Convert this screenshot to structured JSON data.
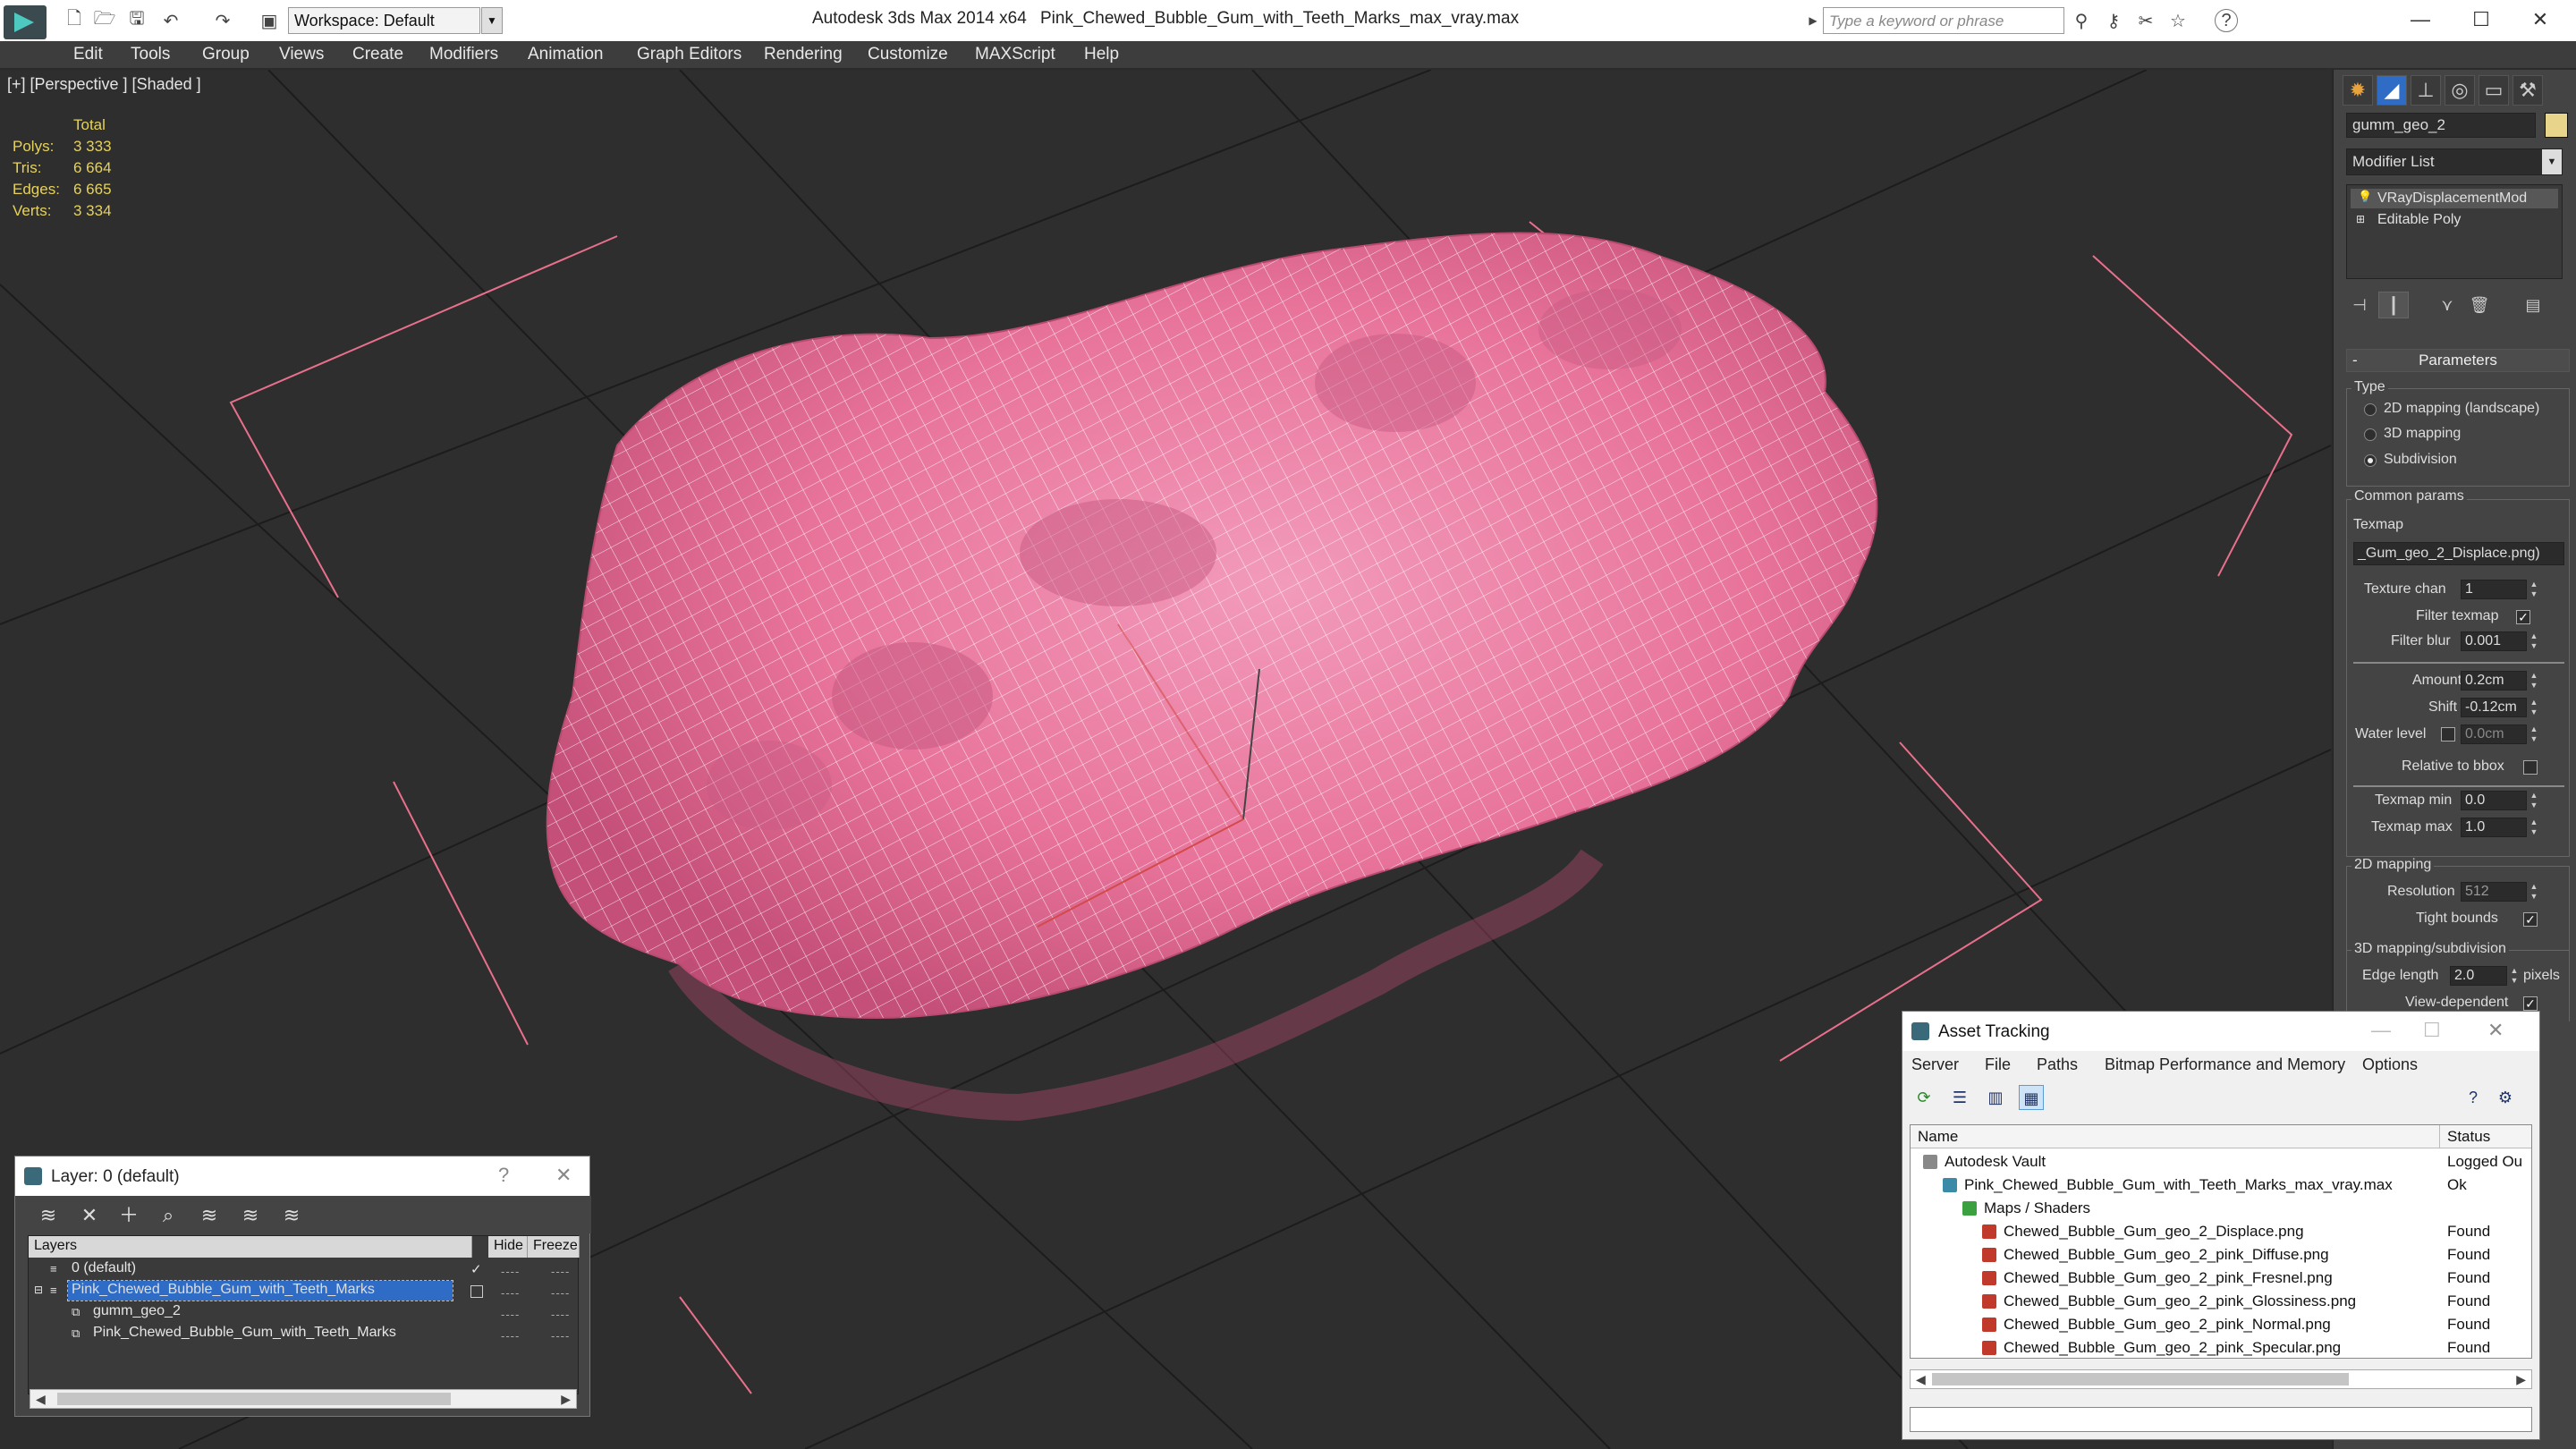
{
  "titlebar": {
    "workspace": "Workspace: Default",
    "app_name": "Autodesk 3ds Max  2014 x64",
    "file_name": "Pink_Chewed_Bubble_Gum_with_Teeth_Marks_max_vray.max",
    "search_placeholder": "Type a keyword or phrase",
    "help_label": "?",
    "minimize": "—",
    "maximize": "☐",
    "close": "✕"
  },
  "menubar": [
    "Edit",
    "Tools",
    "Group",
    "Views",
    "Create",
    "Modifiers",
    "Animation",
    "Graph Editors",
    "Rendering",
    "Customize",
    "MAXScript",
    "Help"
  ],
  "viewport": {
    "label": "[+] [Perspective ] [Shaded ]",
    "stats": {
      "header": "Total",
      "rows": [
        {
          "label": "Polys:",
          "value": "3 333"
        },
        {
          "label": "Tris:",
          "value": "6 664"
        },
        {
          "label": "Edges:",
          "value": "6 665"
        },
        {
          "label": "Verts:",
          "value": "3 334"
        }
      ]
    },
    "object_color": "#e8739a",
    "wire_color": "#ffffff",
    "bbox_color": "#e8708c"
  },
  "command_panel": {
    "object_name": "gumm_geo_2",
    "object_color": "#e8d48a",
    "modifier_list": "Modifier List",
    "stack": [
      "VRayDisplacementMod",
      "Editable Poly"
    ],
    "rollout_title": "Parameters",
    "collapse_sign": "-",
    "type_label": "Type",
    "type_options": [
      "2D mapping (landscape)",
      "3D mapping",
      "Subdivision"
    ],
    "type_selected": 2,
    "common_label": "Common params",
    "texmap_label": "Texmap",
    "texmap_value": "_Gum_geo_2_Displace.png)",
    "texture_chan_label": "Texture chan",
    "texture_chan_value": "1",
    "filter_texmap_label": "Filter texmap",
    "filter_blur_label": "Filter blur",
    "filter_blur_value": "0.001",
    "amount_label": "Amount",
    "amount_value": "0.2cm",
    "shift_label": "Shift",
    "shift_value": "-0.12cm",
    "water_label": "Water level",
    "water_value": "0.0cm",
    "relative_label": "Relative to bbox",
    "texmap_min_label": "Texmap min",
    "texmap_min_value": "0.0",
    "texmap_max_label": "Texmap max",
    "texmap_max_value": "1.0",
    "mapping2d_label": "2D mapping",
    "resolution_label": "Resolution",
    "resolution_value": "512",
    "tight_label": "Tight bounds",
    "mapping3d_label": "3D mapping/subdivision",
    "edge_length_label": "Edge length",
    "edge_length_value": "2.0",
    "pixels_label": "pixels",
    "view_dependent_label": "View-dependent",
    "check_mark": "✓"
  },
  "layer_window": {
    "title": "Layer: 0 (default)",
    "help": "?",
    "close": "✕",
    "columns": [
      "Layers",
      "Hide",
      "Freeze"
    ],
    "rows": [
      {
        "name": "0 (default)",
        "indent": 0,
        "selected": false,
        "active": true
      },
      {
        "name": "Pink_Chewed_Bubble_Gum_with_Teeth_Marks",
        "indent": 0,
        "selected": true,
        "active": false
      },
      {
        "name": "gumm_geo_2",
        "indent": 1,
        "selected": false,
        "active": false
      },
      {
        "name": "Pink_Chewed_Bubble_Gum_with_Teeth_Marks",
        "indent": 1,
        "selected": false,
        "active": false
      }
    ],
    "dots": "----"
  },
  "asset_window": {
    "title": "Asset Tracking",
    "menu": [
      "Server",
      "File",
      "Paths",
      "Bitmap Performance and Memory",
      "Options"
    ],
    "columns": [
      "Name",
      "Status"
    ],
    "rows": [
      {
        "name": "Autodesk Vault",
        "status": "Logged Ou",
        "indent": 0,
        "icon": "vault-icon"
      },
      {
        "name": "Pink_Chewed_Bubble_Gum_with_Teeth_Marks_max_vray.max",
        "status": "Ok",
        "indent": 1,
        "icon": "max-file-icon"
      },
      {
        "name": "Maps / Shaders",
        "status": "",
        "indent": 2,
        "icon": "maps-icon"
      },
      {
        "name": "Chewed_Bubble_Gum_geo_2_Displace.png",
        "status": "Found",
        "indent": 3,
        "icon": "png-icon"
      },
      {
        "name": "Chewed_Bubble_Gum_geo_2_pink_Diffuse.png",
        "status": "Found",
        "indent": 3,
        "icon": "png-icon"
      },
      {
        "name": "Chewed_Bubble_Gum_geo_2_pink_Fresnel.png",
        "status": "Found",
        "indent": 3,
        "icon": "png-icon"
      },
      {
        "name": "Chewed_Bubble_Gum_geo_2_pink_Glossiness.png",
        "status": "Found",
        "indent": 3,
        "icon": "png-icon"
      },
      {
        "name": "Chewed_Bubble_Gum_geo_2_pink_Normal.png",
        "status": "Found",
        "indent": 3,
        "icon": "png-icon"
      },
      {
        "name": "Chewed_Bubble_Gum_geo_2_pink_Specular.png",
        "status": "Found",
        "indent": 3,
        "icon": "png-icon"
      }
    ]
  }
}
